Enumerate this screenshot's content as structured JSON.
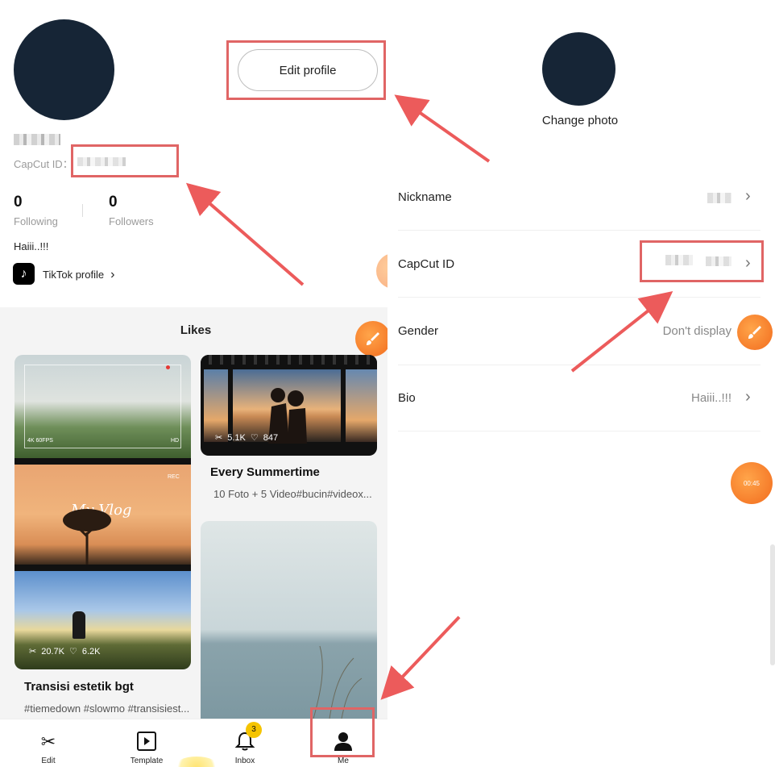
{
  "profile": {
    "capcut_id_label": "CapCut ID：",
    "following_count": "0",
    "following_label": "Following",
    "followers_count": "0",
    "followers_label": "Followers",
    "bio": "Haiii..!!!",
    "tiktok_label": "TikTok profile",
    "edit_button": "Edit profile"
  },
  "likes": {
    "title": "Likes",
    "cards": [
      {
        "overlay_labels": [
          "4K 60FPS",
          "HD",
          "REC",
          "My Vlog"
        ],
        "uses": "20.7K",
        "likes": "6.2K",
        "title": "Transisi estetik bgt",
        "tags": "#tiemedown #slowmo #transisiest..."
      },
      {
        "uses": "5.1K",
        "likes": "847",
        "title": "Every Summertime",
        "tags": "10 Foto + 5 Video#bucin#videox..."
      }
    ]
  },
  "nav": {
    "items": [
      {
        "label": "Edit",
        "icon": "scissors-icon"
      },
      {
        "label": "Template",
        "icon": "template-icon"
      },
      {
        "label": "Inbox",
        "icon": "bell-icon"
      },
      {
        "label": "Me",
        "icon": "person-icon"
      }
    ],
    "inbox_badge": "3"
  },
  "edit_screen": {
    "change_photo": "Change photo",
    "rows": [
      {
        "label": "Nickname",
        "value": ""
      },
      {
        "label": "CapCut ID",
        "value": ""
      },
      {
        "label": "Gender",
        "value": "Don't display"
      },
      {
        "label": "Bio",
        "value": "Haiii..!!!"
      }
    ],
    "timer": "00:45"
  },
  "colors": {
    "highlight": "#e06565",
    "avatar": "#162536",
    "orange": "#f26b1d",
    "badge": "#f5c400"
  }
}
